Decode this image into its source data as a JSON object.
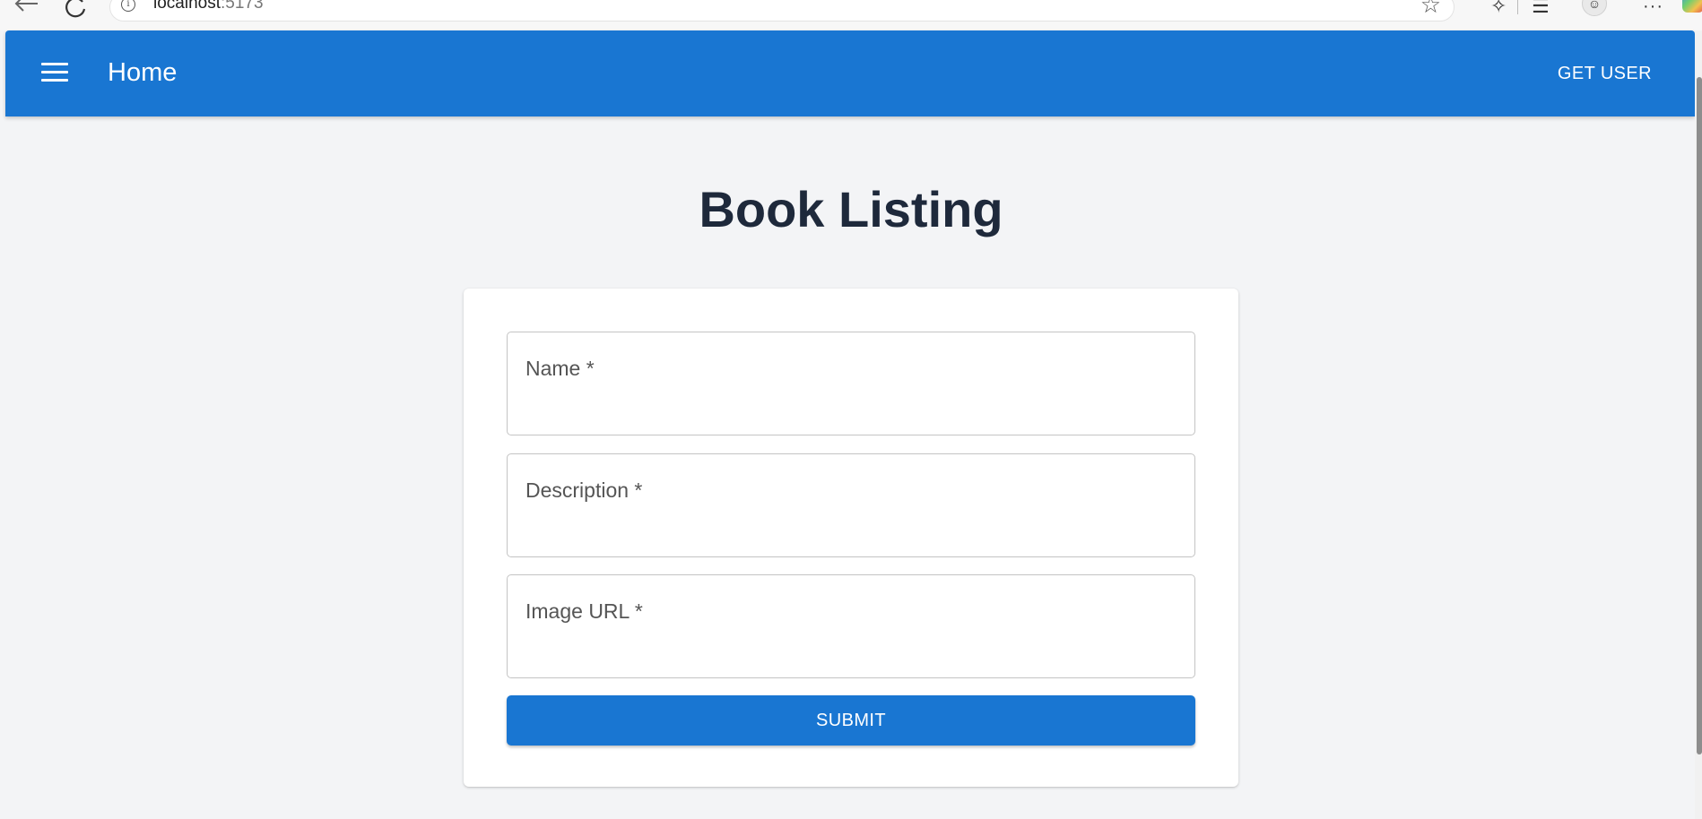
{
  "browser": {
    "url_host": "localhost",
    "url_port": ":5173"
  },
  "app_bar": {
    "title": "Home",
    "get_user_label": "GET USER",
    "color": "#1976d2"
  },
  "page": {
    "heading": "Book Listing"
  },
  "form": {
    "fields": [
      {
        "label": "Name *",
        "value": ""
      },
      {
        "label": "Description *",
        "value": ""
      },
      {
        "label": "Image URL *",
        "value": ""
      }
    ],
    "submit_label": "SUBMIT"
  },
  "icons": {
    "menu": "menu-icon",
    "back": "back-arrow-icon",
    "reload": "reload-icon",
    "site_info": "info-icon",
    "favorite": "star-icon",
    "extensions": "puzzle-icon",
    "favorites": "favorites-icon",
    "profile": "profile-icon",
    "more": "more-icon"
  }
}
